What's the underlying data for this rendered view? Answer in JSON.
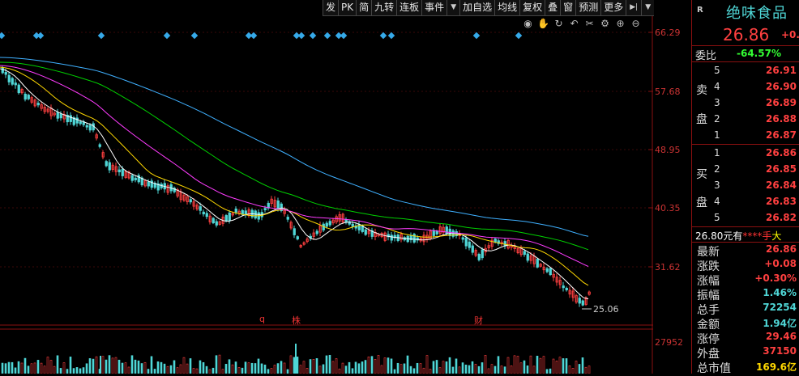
{
  "toolbar": {
    "items": [
      "发",
      "PK",
      "简",
      "九转",
      "连板",
      "事件",
      "▼",
      "加自选",
      "均线",
      "复权",
      "叠",
      "窗",
      "预测",
      "更多",
      "▶|",
      "▼"
    ]
  },
  "chart": {
    "y_ticks": [
      "66.29",
      "57.68",
      "48.95",
      "40.35",
      "31.62"
    ],
    "low_label": "25.06",
    "volume_tick": "27952",
    "event_markers": [
      "q",
      "株",
      "财"
    ]
  },
  "quote": {
    "r_mark": "R",
    "name": "绝味食品",
    "price": "26.86",
    "change": "+0.",
    "weibi_label": "委比",
    "weibi_value": "-64.57%",
    "sell_label_chars": [
      "卖",
      "盘"
    ],
    "buy_label_chars": [
      "买",
      "盘"
    ],
    "asks": [
      {
        "level": "5",
        "price": "26.91"
      },
      {
        "level": "4",
        "price": "26.90"
      },
      {
        "level": "3",
        "price": "26.89"
      },
      {
        "level": "2",
        "price": "26.88"
      },
      {
        "level": "1",
        "price": "26.87"
      }
    ],
    "bids": [
      {
        "level": "1",
        "price": "26.86"
      },
      {
        "level": "2",
        "price": "26.85"
      },
      {
        "level": "3",
        "price": "26.84"
      },
      {
        "level": "4",
        "price": "26.83"
      },
      {
        "level": "5",
        "price": "26.82"
      }
    ],
    "last_trade": {
      "price": "26.80元有",
      "stars": "****手",
      "tail": "大"
    },
    "stats": [
      {
        "label": "最新",
        "value": "26.86",
        "color": "red"
      },
      {
        "label": "涨跌",
        "value": "+0.08",
        "color": "red"
      },
      {
        "label": "涨幅",
        "value": "+0.30%",
        "color": "red"
      },
      {
        "label": "振幅",
        "value": "1.46%",
        "color": "cyan"
      },
      {
        "label": "总手",
        "value": "72254",
        "color": "cyan"
      },
      {
        "label": "金额",
        "value": "1.94亿",
        "color": "cyan"
      },
      {
        "label": "涨停",
        "value": "29.46",
        "color": "red"
      },
      {
        "label": "外盘",
        "value": "37150",
        "color": "red"
      },
      {
        "label": "总市值",
        "value": "169.6亿",
        "color": "yel"
      }
    ]
  },
  "colors": {
    "up": "#ff4040",
    "down": "#4fd6d6",
    "axis": "#8a1010",
    "ma5": "#ffffff",
    "ma10": "#ffd800",
    "ma20": "#ff3cff",
    "ma60": "#00d000",
    "ma120": "#3fb0ff"
  }
}
